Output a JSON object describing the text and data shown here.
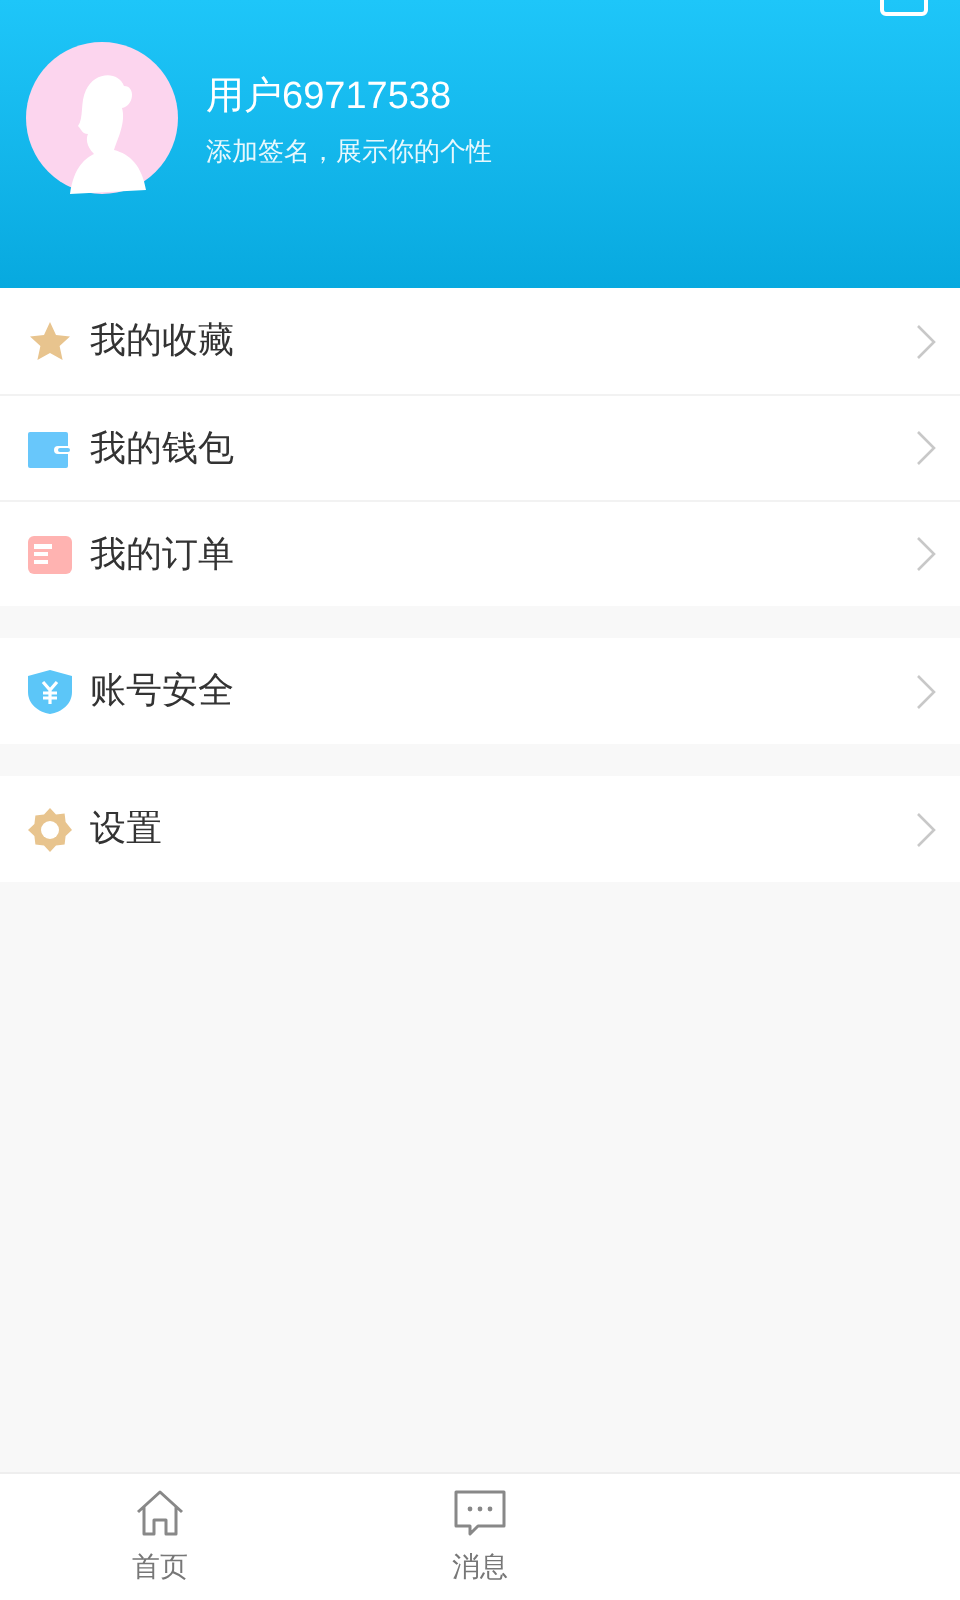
{
  "profile": {
    "username": "用户69717538",
    "signature": "添加签名，展示你的个性"
  },
  "menu_groups": [
    {
      "items": [
        {
          "kind": "star",
          "label": "我的收藏"
        },
        {
          "kind": "wallet",
          "label": "我的钱包"
        },
        {
          "kind": "order",
          "label": "我的订单"
        }
      ]
    },
    {
      "items": [
        {
          "kind": "shield",
          "label": "账号安全"
        }
      ]
    },
    {
      "items": [
        {
          "kind": "gear",
          "label": "设置"
        }
      ]
    }
  ],
  "bottom_nav": [
    {
      "kind": "home",
      "label": "首页"
    },
    {
      "kind": "message",
      "label": "消息"
    }
  ]
}
